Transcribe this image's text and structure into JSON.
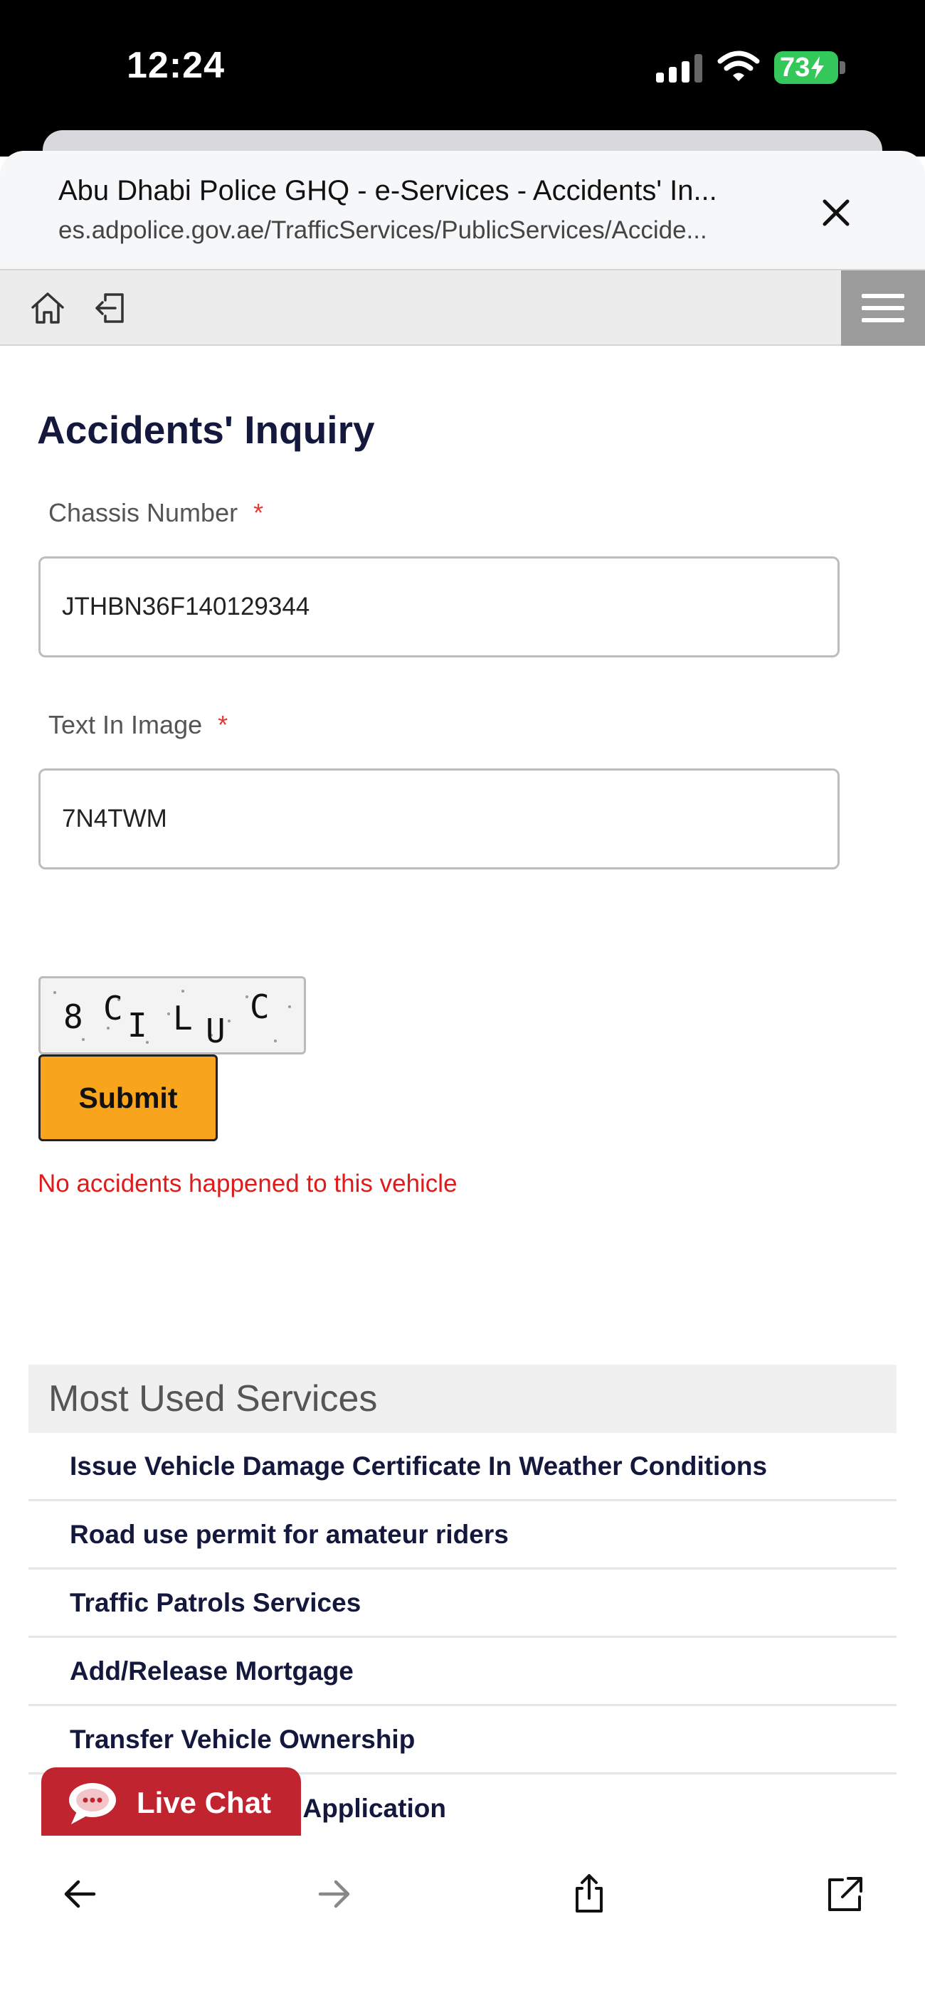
{
  "status_bar": {
    "time": "12:24",
    "battery": "73"
  },
  "browser": {
    "title": "Abu Dhabi Police GHQ - e-Services - Accidents' In...",
    "url": "es.adpolice.gov.ae/TrafficServices/PublicServices/Accide..."
  },
  "nav": {
    "icons": [
      "home-icon",
      "logout-icon",
      "menu-icon"
    ]
  },
  "form": {
    "heading": "Accidents' Inquiry",
    "chassis_label": "Chassis Number",
    "chassis_value": "JTHBN36F140129344",
    "text_image_label": "Text In Image",
    "text_image_value": "7N4TWM",
    "required_mark": "*",
    "captcha_text": [
      "8",
      "C",
      "I",
      "L",
      "U",
      "C"
    ],
    "submit_label": "Submit",
    "result_message": "No accidents happened to this vehicle"
  },
  "most_used": {
    "title": "Most Used Services",
    "items": [
      "Issue Vehicle Damage Certificate In Weather Conditions",
      "Road use permit for amateur riders",
      "Traffic Patrols Services",
      "Add/Release Mortgage",
      "Transfer Vehicle Ownership",
      "e Application"
    ]
  },
  "live_chat": {
    "label": "Live Chat"
  },
  "toolbar": {
    "icons": [
      "back-icon",
      "forward-icon",
      "share-icon",
      "open-external-icon"
    ]
  },
  "colors": {
    "accent": "#f9a41d",
    "error": "#e01b1b",
    "heading": "#14183d",
    "chat": "#c0242f"
  }
}
